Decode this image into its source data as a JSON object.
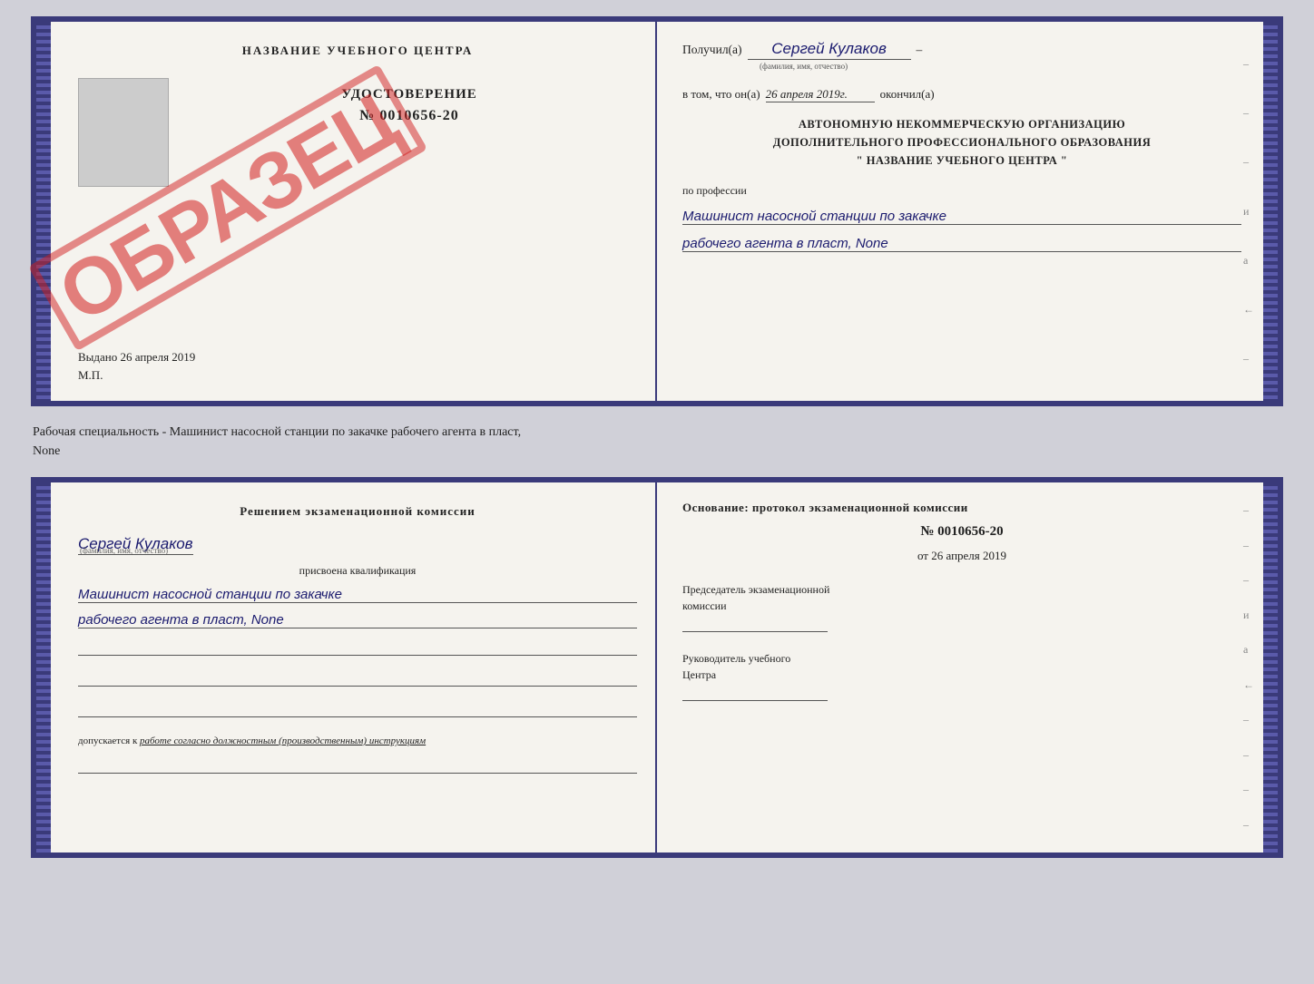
{
  "top_doc": {
    "left": {
      "title": "НАЗВАНИЕ УЧЕБНОГО ЦЕНТРА",
      "udostoverenie_label": "УДОСТОВЕРЕНИЕ",
      "number": "№ 0010656-20",
      "vydano_label": "Выдано",
      "vydano_date": "26 апреля 2019",
      "mp": "М.П."
    },
    "stamp": "ОБРАЗЕЦ",
    "right": {
      "poluchil_prefix": "Получил(а)",
      "recipient_name": "Сергей Кулаков",
      "fio_hint": "(фамилия, имя, отчество)",
      "dash": "–",
      "vtom_prefix": "в том, что он(а)",
      "vtom_date": "26 апреля 2019г.",
      "okonchil": "окончил(а)",
      "org_line1": "АВТОНОМНУЮ НЕКОММЕРЧЕСКУЮ ОРГАНИЗАЦИЮ",
      "org_line2": "ДОПОЛНИТЕЛЬНОГО ПРОФЕССИОНАЛЬНОГО ОБРАЗОВАНИЯ",
      "org_line3": "\" НАЗВАНИЕ УЧЕБНОГО ЦЕНТРА \"",
      "po_professii": "по профессии",
      "profession1": "Машинист насосной станции по закачке",
      "profession2": "рабочего агента в пласт, None"
    }
  },
  "middle": {
    "text": "Рабочая специальность - Машинист насосной станции по закачке рабочего агента в пласт,",
    "text2": "None"
  },
  "bottom_doc": {
    "left": {
      "resheniem": "Решением экзаменационной комиссии",
      "name": "Сергей Кулаков",
      "fio_hint": "(фамилия, имя, отчество)",
      "prisvoena": "присвоена квалификация",
      "qual1": "Машинист насосной станции по закачке",
      "qual2": "рабочего агента в пласт, None",
      "dopuskaetsya": "допускается к",
      "dopuskaetsya_val": "работе согласно должностным (производственным) инструкциям"
    },
    "right": {
      "osnovanie": "Основание: протокол экзаменационной комиссии",
      "number": "№ 0010656-20",
      "ot_prefix": "от",
      "ot_date": "26 апреля 2019",
      "predsedatel1": "Председатель экзаменационной",
      "predsedatel2": "комиссии",
      "rukovoditel1": "Руководитель учебного",
      "rukovoditel2": "Центра"
    }
  },
  "dashes": [
    "–",
    "–",
    "–",
    "–",
    "и",
    "а",
    "←",
    "–",
    "–",
    "–",
    "–",
    "–"
  ]
}
